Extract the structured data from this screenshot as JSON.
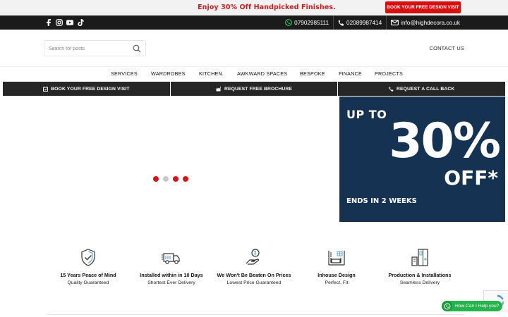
{
  "promo": {
    "text": "Enjoy 30% Off Handpicked Finishes.",
    "button_label": "BOOK YOUR FREE DESIGN VISIT"
  },
  "topbar": {
    "social_icons": [
      "facebook-icon",
      "instagram-icon",
      "youtube-icon",
      "tiktok-icon"
    ],
    "whatsapp_phone": "07902985111",
    "phone": "02089987414",
    "email": "info@highdecora.co.uk"
  },
  "header": {
    "search_placeholder": "Search for posts",
    "contact_us": "CONTACT US"
  },
  "nav": {
    "items": [
      "SERVICES",
      "WARDROBES",
      "KITCHEN",
      "AWKWARD SPACES",
      "BESPOKE",
      "FINANCE",
      "PROJECTS"
    ]
  },
  "cta": {
    "visit": "BOOK YOUR FREE DESIGN VISIT",
    "brochure": "REQUEST FREE BROCHURE",
    "callback": "REQUEST A CALL BACK"
  },
  "slider": {
    "dots": 4,
    "active_states": [
      true,
      false,
      true,
      true
    ]
  },
  "offer": {
    "up_to": "UP TO",
    "percent": "30%",
    "off": "OFF*",
    "ends": "ENDS IN 2 WEEKS",
    "background": "#163253"
  },
  "features": [
    {
      "title": "15 Years Peace of Mind",
      "subtitle": "Quality Guaranteed",
      "icon": "shield-check-icon"
    },
    {
      "title": "Installed within in 10 Days",
      "subtitle": "Shortest Ever Delivery",
      "icon": "delivery-truck-icon"
    },
    {
      "title": "We Won't Be Beaten On Prices",
      "subtitle": "Lowest Price Guaranteed",
      "icon": "price-hand-icon"
    },
    {
      "title": "Inhouse Design",
      "subtitle": "Perfect, Fit",
      "icon": "room-design-icon"
    },
    {
      "title": "Production & Installations",
      "subtitle": "Seamless Delivery",
      "icon": "wardrobe-install-icon"
    }
  ],
  "widgets": {
    "whatsapp_label": "How Can I Help you?"
  },
  "colors": {
    "accent_red": "#d80f0f",
    "topbar": "#1b1b1b",
    "cta_bar": "#262626",
    "offer_navy": "#163253",
    "whatsapp_green": "#25b34b"
  }
}
